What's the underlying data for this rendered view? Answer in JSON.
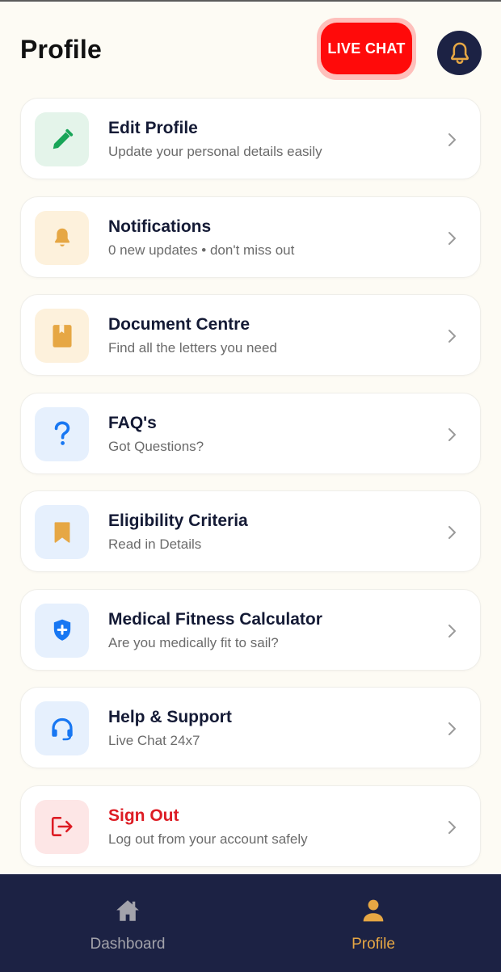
{
  "header": {
    "title": "Profile",
    "live_chat_label": "LIVE CHAT",
    "notification_icon": "bell-icon"
  },
  "menu": {
    "items": [
      {
        "title": "Edit Profile",
        "subtitle": "Update your personal details easily",
        "icon": "pencil-icon",
        "icon_color": "#18a558",
        "tile_color": "#e4f4ea"
      },
      {
        "title": "Notifications",
        "subtitle": "0 new updates • don't miss out",
        "icon": "bell-icon",
        "icon_color": "#e6a744",
        "tile_color": "#fdf1dc"
      },
      {
        "title": "Document Centre",
        "subtitle": "Find all the letters you need",
        "icon": "book-icon",
        "icon_color": "#e6a744",
        "tile_color": "#fdf1dc"
      },
      {
        "title": "FAQ's",
        "subtitle": "Got Questions?",
        "icon": "question-icon",
        "icon_color": "#1877f2",
        "tile_color": "#e6f0fd"
      },
      {
        "title": "Eligibility Criteria",
        "subtitle": "Read in Details",
        "icon": "bookmark-icon",
        "icon_color": "#e6a744",
        "tile_color": "#e6f0fd"
      },
      {
        "title": "Medical Fitness Calculator",
        "subtitle": "Are you medically fit to sail?",
        "icon": "shield-plus-icon",
        "icon_color": "#1877f2",
        "tile_color": "#e6f0fd"
      },
      {
        "title": "Help & Support",
        "subtitle": "Live Chat 24x7",
        "icon": "headset-icon",
        "icon_color": "#1877f2",
        "tile_color": "#e6f0fd"
      },
      {
        "title": "Sign Out",
        "subtitle": "Log out from your account safely",
        "icon": "logout-icon",
        "icon_color": "#dd1c24",
        "tile_color": "#fde6e6"
      }
    ]
  },
  "nav": {
    "dashboard_label": "Dashboard",
    "profile_label": "Profile",
    "active": "Profile"
  },
  "colors": {
    "background": "#fdfbf4",
    "navy": "#1c2244",
    "live_chat_red": "#ff0a0a",
    "active_nav": "#e6a744"
  }
}
